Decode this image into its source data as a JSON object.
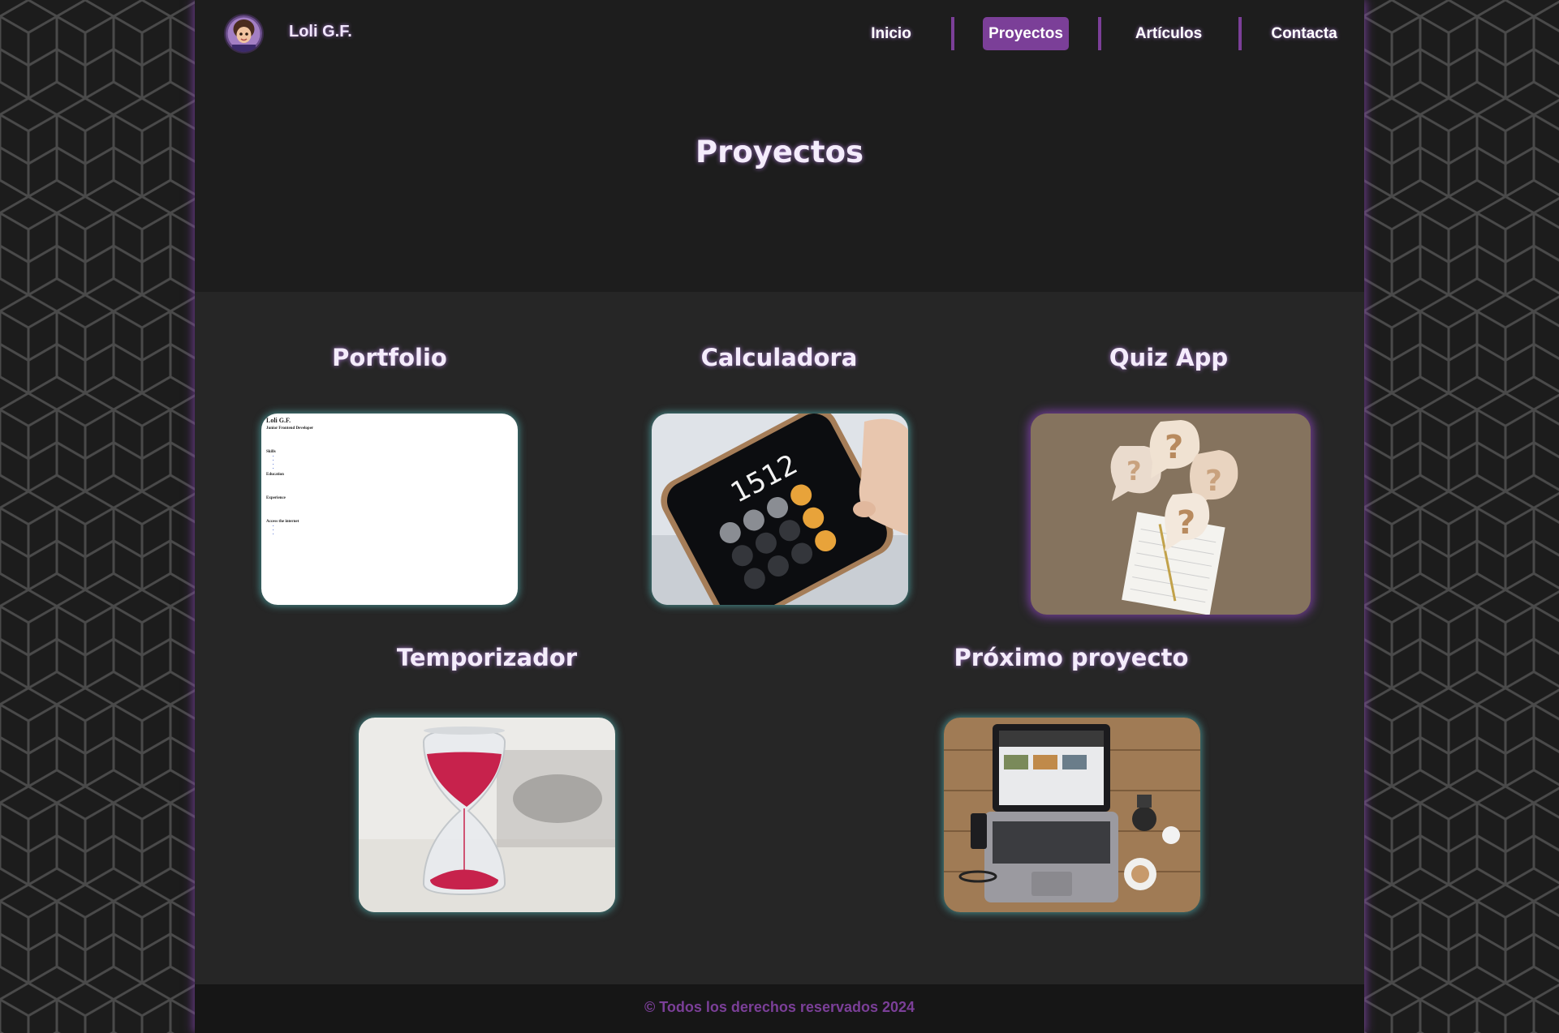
{
  "header": {
    "brand": "Loli G.F.",
    "nav": [
      {
        "label": "Inicio",
        "active": false
      },
      {
        "label": "Proyectos",
        "active": true
      },
      {
        "label": "Artículos",
        "active": false
      },
      {
        "label": "Contacta",
        "active": false
      }
    ]
  },
  "hero": {
    "title": "Proyectos"
  },
  "projects": [
    {
      "title": "Portfolio",
      "image": "resume-document-thumbnail"
    },
    {
      "title": "Calculadora",
      "image": "smartphone-calculator-photo"
    },
    {
      "title": "Quiz App",
      "image": "question-mark-notes-photo"
    },
    {
      "title": "Temporizador",
      "image": "hourglass-photo"
    },
    {
      "title": "Próximo proyecto",
      "image": "laptop-desk-photo"
    }
  ],
  "portfolio_doc": {
    "name": "Loli G.F.",
    "role": "Junior Frontend Developer",
    "sections": [
      "Skills",
      "Education",
      "Experience",
      "Access the internet"
    ]
  },
  "calculator_display": "1512",
  "footer": {
    "text": "© Todos los derechos reservados 2024"
  },
  "colors": {
    "accent": "#7b3f98",
    "card_glow": "#5ac8c8",
    "background": "#1d1d1d"
  }
}
